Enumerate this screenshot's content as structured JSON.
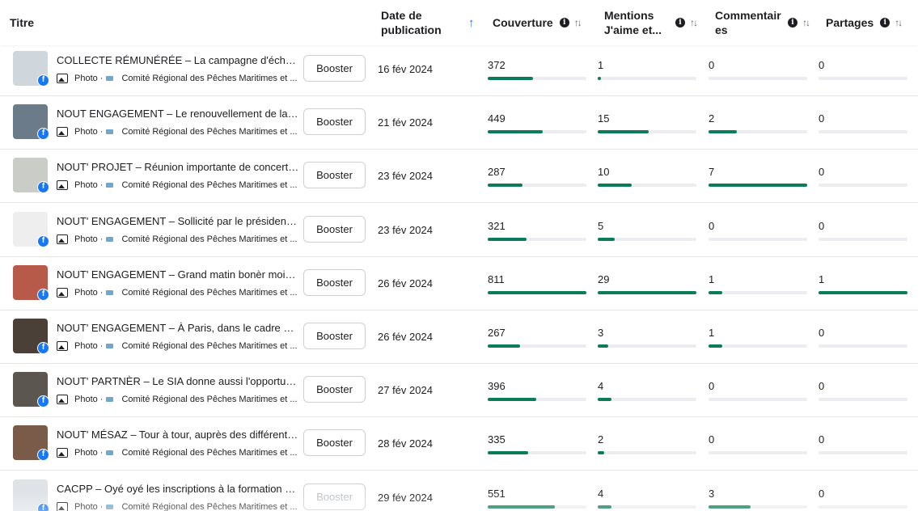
{
  "header": {
    "title": "Titre",
    "date": "Date de publication",
    "reach": "Couverture",
    "likes": "Mentions J'aime et...",
    "comments": "Commentaires",
    "shares": "Partages"
  },
  "metric_max": {
    "reach": 811,
    "likes": 29,
    "comments": 7,
    "shares": 1
  },
  "colors": {
    "bar": "#0a7c59",
    "track": "#ebedf0",
    "facebook": "#1877f2"
  },
  "rows": [
    {
      "title": "COLLECTE RÉMUNÉRÉE – La campagne d'échantillo...",
      "type": "Photo ·",
      "page": "Comité Régional des Pêches Maritimes et ...",
      "boost": "Booster",
      "boost_enabled": true,
      "date": "16 fév 2024",
      "reach": "372",
      "likes": "1",
      "comments": "0",
      "shares": "0",
      "thumb_color": "#cfd6dc"
    },
    {
      "title": "NOUT ENGAGEMENT – Le renouvellement de la flo...",
      "type": "Photo ·",
      "page": "Comité Régional des Pêches Maritimes et ...",
      "boost": "Booster",
      "boost_enabled": true,
      "date": "21 fév 2024",
      "reach": "449",
      "likes": "15",
      "comments": "2",
      "shares": "0",
      "thumb_color": "#6b7b8a"
    },
    {
      "title": "NOUT' PROJET – Réunion importante de concertati...",
      "type": "Photo ·",
      "page": "Comité Régional des Pêches Maritimes et ...",
      "boost": "Booster",
      "boost_enabled": true,
      "date": "23 fév 2024",
      "reach": "287",
      "likes": "10",
      "comments": "7",
      "shares": "0",
      "thumb_color": "#c9ccc7"
    },
    {
      "title": "NOUT' ENGAGEMENT – Sollicité par le président d...",
      "type": "Photo ·",
      "page": "Comité Régional des Pêches Maritimes et ...",
      "boost": "Booster",
      "boost_enabled": true,
      "date": "23 fév 2024",
      "reach": "321",
      "likes": "5",
      "comments": "0",
      "shares": "0",
      "thumb_color": "#eeeeee"
    },
    {
      "title": "NOUT' ENGAGEMENT – Grand matin bonèr moin lk...",
      "type": "Photo ·",
      "page": "Comité Régional des Pêches Maritimes et ...",
      "boost": "Booster",
      "boost_enabled": true,
      "date": "26 fév 2024",
      "reach": "811",
      "likes": "29",
      "comments": "1",
      "shares": "1",
      "thumb_color": "#b85a4a"
    },
    {
      "title": "NOUT' ENGAGEMENT – À Paris, dans le cadre de la...",
      "type": "Photo ·",
      "page": "Comité Régional des Pêches Maritimes et ...",
      "boost": "Booster",
      "boost_enabled": true,
      "date": "26 fév 2024",
      "reach": "267",
      "likes": "3",
      "comments": "1",
      "shares": "0",
      "thumb_color": "#4a4038"
    },
    {
      "title": "NOUT' PARTNÈR – Le SIA donne aussi l'opportunité...",
      "type": "Photo ·",
      "page": "Comité Régional des Pêches Maritimes et ...",
      "boost": "Booster",
      "boost_enabled": true,
      "date": "27 fév 2024",
      "reach": "396",
      "likes": "4",
      "comments": "0",
      "shares": "0",
      "thumb_color": "#5c5650"
    },
    {
      "title": "NOUT' MÉSAZ – Tour à tour, auprès des différents ...",
      "type": "Photo ·",
      "page": "Comité Régional des Pêches Maritimes et ...",
      "boost": "Booster",
      "boost_enabled": true,
      "date": "28 fév 2024",
      "reach": "335",
      "likes": "2",
      "comments": "0",
      "shares": "0",
      "thumb_color": "#7a5a48"
    },
    {
      "title": "CACPP – Oyé oyé les inscriptions à la formation Cer...",
      "type": "Photo ·",
      "page": "Comité Régional des Pêches Maritimes et ...",
      "boost": "Booster",
      "boost_enabled": false,
      "date": "29 fév 2024",
      "reach": "551",
      "likes": "4",
      "comments": "3",
      "shares": "0",
      "thumb_color": "#dfe3e8"
    }
  ]
}
